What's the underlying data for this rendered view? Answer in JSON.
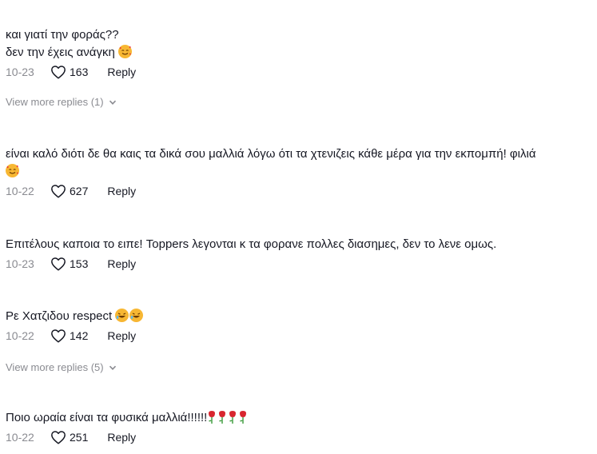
{
  "comments": [
    {
      "lines": [
        "και γιατί την φοράς??",
        "δεν την έχεις ανάγκη"
      ],
      "emoji": "smiling-hearts",
      "date": "10-23",
      "likes": "163",
      "reply": "Reply",
      "view_more": "View more replies (1)"
    },
    {
      "text": "είναι καλό διότι δε θα καις τα δικά σου μαλλιά λόγω ότι τα χτενιζεις κάθε μέρα για την εκπομπή! φιλιά",
      "emoji": "smiling-hearts",
      "date": "10-22",
      "likes": "627",
      "reply": "Reply"
    },
    {
      "text": "Επιτέλους καποια το ειπε! Toppers λεγονται κ τα φορανε πολλες διασημες, δεν το λενε ομως.",
      "date": "10-23",
      "likes": "153",
      "reply": "Reply"
    },
    {
      "text": "Ρε Χατζιδου respect",
      "emoji": "rofl",
      "date": "10-22",
      "likes": "142",
      "reply": "Reply",
      "view_more": "View more replies (5)"
    },
    {
      "text": "Ποιο ωραία είναι τα φυσικά μαλλιά!!!!!!",
      "emoji": "rose",
      "date": "10-22",
      "likes": "251",
      "reply": "Reply"
    }
  ]
}
